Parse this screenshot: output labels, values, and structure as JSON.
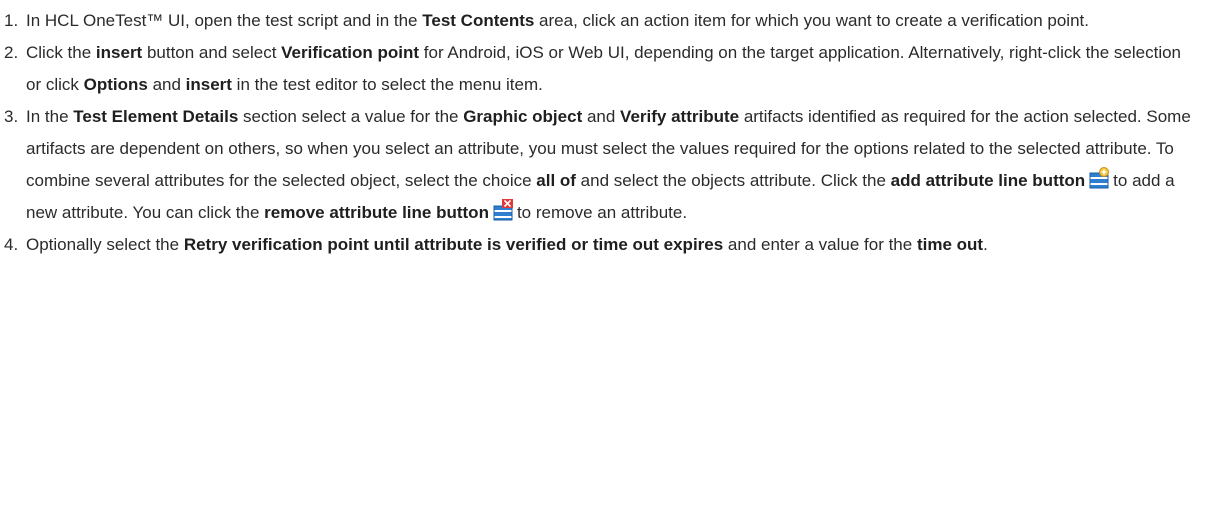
{
  "steps": [
    {
      "number": "1.",
      "segments": [
        {
          "t": "In HCL OneTest™ UI, open the test script and in the ",
          "b": false
        },
        {
          "t": "Test Contents",
          "b": true
        },
        {
          "t": " area, click an action item for which you want to create a verification point.",
          "b": false
        }
      ]
    },
    {
      "number": "2.",
      "segments": [
        {
          "t": "Click the ",
          "b": false
        },
        {
          "t": "insert",
          "b": true
        },
        {
          "t": " button and select ",
          "b": false
        },
        {
          "t": "Verification point",
          "b": true
        },
        {
          "t": " for Android, iOS or Web UI, depending on the target application. Alternatively, right-click the selection or click ",
          "b": false
        },
        {
          "t": "Options",
          "b": true
        },
        {
          "t": " and ",
          "b": false
        },
        {
          "t": "insert",
          "b": true
        },
        {
          "t": " in the test editor to select the menu item.",
          "b": false
        }
      ]
    },
    {
      "number": "3.",
      "segments": [
        {
          "t": "In the ",
          "b": false
        },
        {
          "t": "Test Element Details",
          "b": true
        },
        {
          "t": " section select a value for the ",
          "b": false
        },
        {
          "t": "Graphic object",
          "b": true
        },
        {
          "t": " and ",
          "b": false
        },
        {
          "t": "Verify attribute",
          "b": true
        },
        {
          "t": " artifacts identified as required for the action selected. Some artifacts are dependent on others, so when you select an attribute, you must select the values required for the options related to the selected attribute. To combine several attributes for the selected object, select the choice ",
          "b": false
        },
        {
          "t": "all of",
          "b": true
        },
        {
          "t": " and select the objects attribute. Click the ",
          "b": false
        },
        {
          "t": "add attribute line button",
          "b": true
        },
        {
          "icon": "add-attribute-line-icon"
        },
        {
          "t": "to add a new attribute. You can click the ",
          "b": false
        },
        {
          "t": "remove attribute line button",
          "b": true
        },
        {
          "icon": "remove-attribute-line-icon"
        },
        {
          "t": "to remove an attribute.",
          "b": false
        }
      ]
    },
    {
      "number": "4.",
      "segments": [
        {
          "t": "Optionally select the ",
          "b": false
        },
        {
          "t": "Retry verification point until attribute is verified or time out expires",
          "b": true
        },
        {
          "t": " and enter a value for the ",
          "b": false
        },
        {
          "t": "time out",
          "b": true
        },
        {
          "t": ".",
          "b": false
        }
      ]
    }
  ]
}
